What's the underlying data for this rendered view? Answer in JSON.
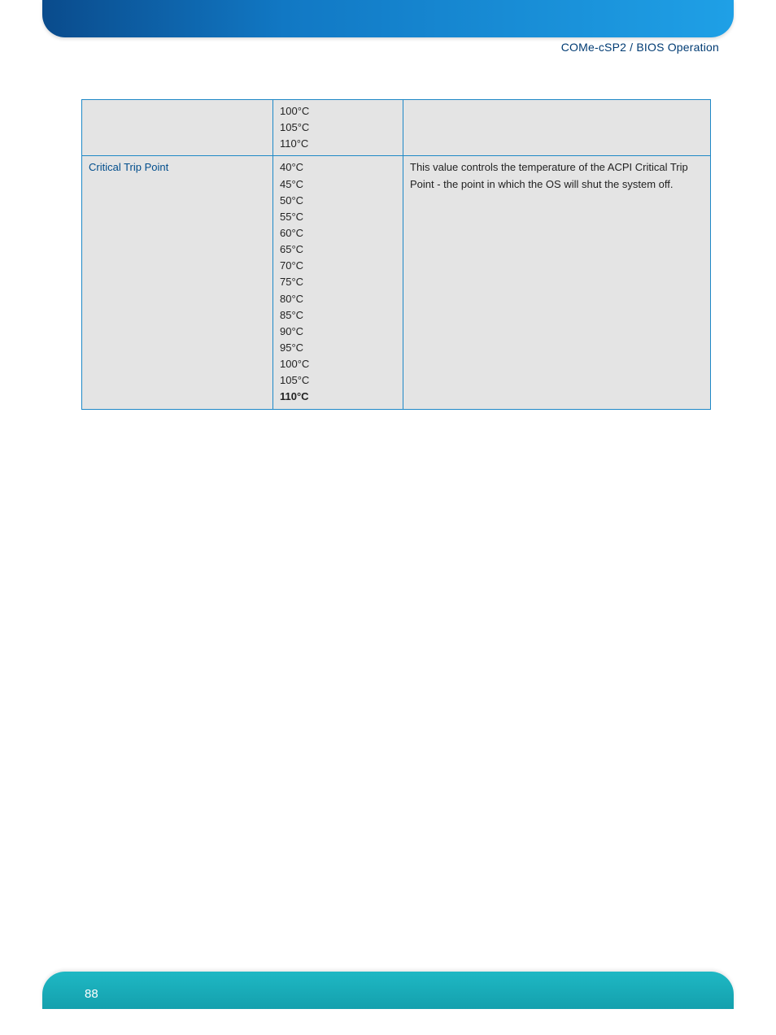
{
  "breadcrumb": "COMe-cSP2 / BIOS Operation",
  "page_number": "88",
  "table": {
    "row0": {
      "label": "",
      "values": [
        "100°C",
        "105°C",
        "110°C"
      ],
      "description": ""
    },
    "row1": {
      "label": "Critical Trip Point",
      "values": [
        "40°C",
        "45°C",
        "50°C",
        "55°C",
        "60°C",
        "65°C",
        "70°C",
        "75°C",
        "80°C",
        "85°C",
        "90°C",
        "95°C",
        "100°C",
        "105°C",
        "110°C"
      ],
      "bold_index": 14,
      "description": "This value controls the temperature of the ACPI Critical Trip Point - the point in which the OS will shut the system off."
    }
  }
}
